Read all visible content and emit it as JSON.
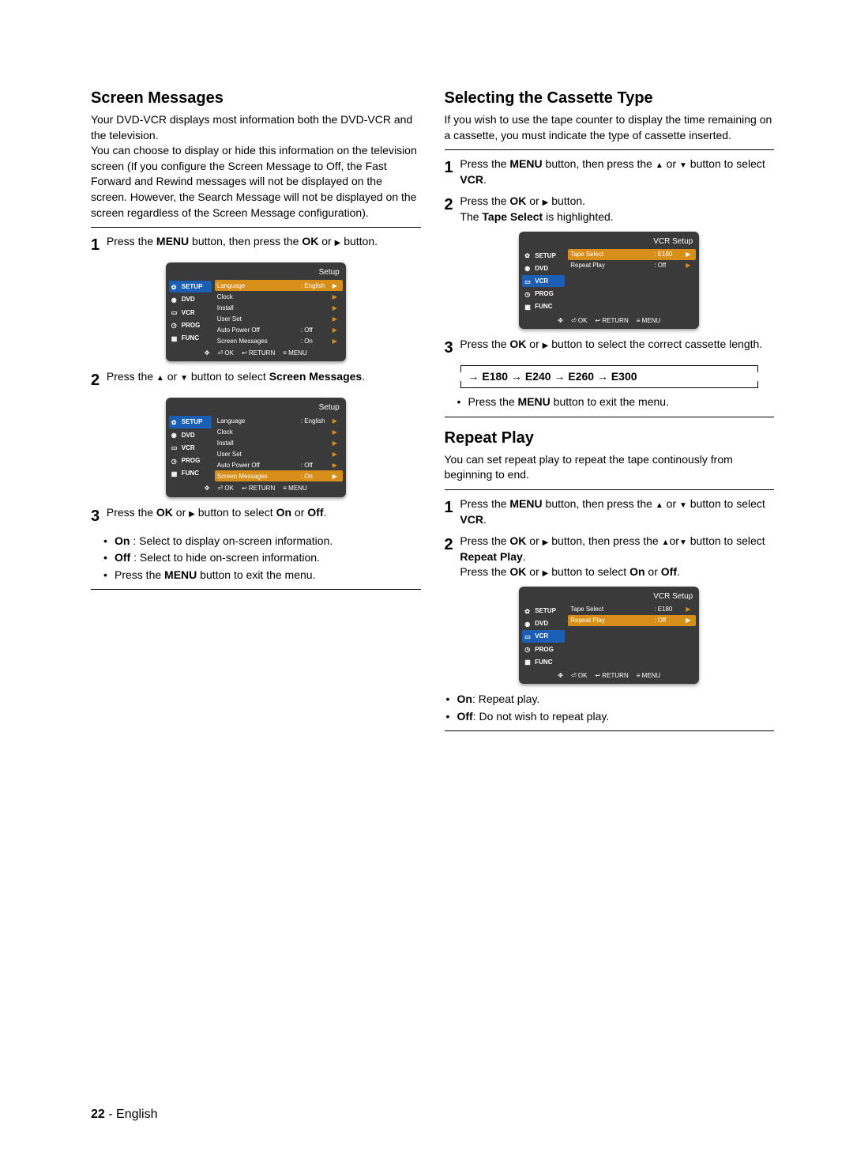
{
  "left": {
    "heading": "Screen Messages",
    "intro": "Your DVD-VCR displays most information both the DVD-VCR and the television.\nYou can choose to display or hide this information on the television screen (If you configure the Screen Message to Off, the Fast Forward and Rewind messages will not be displayed on the screen. However, the Search Message will not be displayed on the screen regardless of the Screen Message configuration).",
    "step1_a": "Press the ",
    "step1_menu": "MENU",
    "step1_b": " button, then press the ",
    "step1_ok": "OK",
    "step1_c": " or ",
    "step1_d": " button.",
    "step2_a": "Press the ",
    "step2_b": " or ",
    "step2_c": " button to select ",
    "step2_sm": "Screen Messages",
    "step2_d": ".",
    "step3_a": "Press the ",
    "step3_ok": "OK",
    "step3_b": " or ",
    "step3_c": " button to select ",
    "step3_on": "On",
    "step3_d": " or ",
    "step3_off": "Off",
    "step3_e": ".",
    "bullet_on_a": "On",
    "bullet_on_b": " : Select to display on-screen information.",
    "bullet_off_a": "Off",
    "bullet_off_b": " : Select to hide on-screen information.",
    "bullet_exit_a": "Press the ",
    "bullet_exit_menu": "MENU",
    "bullet_exit_b": " button to exit the menu."
  },
  "right": {
    "sec1_heading": "Selecting the Cassette Type",
    "sec1_intro": "If you wish to use the tape counter to display the time remaining on a cassette, you must indicate the type of cassette inserted.",
    "s1_step1_a": "Press the ",
    "s1_step1_menu": "MENU",
    "s1_step1_b": " button, then press the ",
    "s1_step1_c": " or ",
    "s1_step1_d": " button to select ",
    "s1_step1_vcr": "VCR",
    "s1_step1_e": ".",
    "s1_step2_a": "Press the ",
    "s1_step2_ok": "OK",
    "s1_step2_b": " or ",
    "s1_step2_c": " button.",
    "s1_step2_d": "The ",
    "s1_step2_ts": "Tape Select",
    "s1_step2_e": " is highlighted.",
    "s1_step3_a": "Press the ",
    "s1_step3_ok": "OK",
    "s1_step3_b": " or ",
    "s1_step3_c": " button to select the correct cassette length.",
    "seq": {
      "e180": "E180",
      "e240": "E240",
      "e260": "E260",
      "e300": "E300"
    },
    "s1_exit_a": "Press the ",
    "s1_exit_menu": "MENU",
    "s1_exit_b": " button to exit the menu.",
    "sec2_heading": "Repeat Play",
    "sec2_intro": "You can set repeat play to repeat the tape continously from beginning to end.",
    "s2_step1_a": "Press the ",
    "s2_step1_menu": "MENU",
    "s2_step1_b": " button, then press the ",
    "s2_step1_c": " or ",
    "s2_step1_d": " button to select ",
    "s2_step1_vcr": "VCR",
    "s2_step1_e": ".",
    "s2_step2_a": "Press the ",
    "s2_step2_ok": "OK",
    "s2_step2_b": " or ",
    "s2_step2_c": " button, then press the ",
    "s2_step2_d": "or",
    "s2_step2_e": " button to select ",
    "s2_step2_rp": "Repeat Play",
    "s2_step2_f": ".",
    "s2_step2_g": "Press the ",
    "s2_step2_ok2": "OK",
    "s2_step2_h": " or ",
    "s2_step2_i": " button to select ",
    "s2_step2_on": "On",
    "s2_step2_j": " or ",
    "s2_step2_off": "Off",
    "s2_step2_k": ".",
    "s2_bul_on_a": "On",
    "s2_bul_on_b": ": Repeat play.",
    "s2_bul_off_a": "Off",
    "s2_bul_off_b": ": Do not wish to repeat play."
  },
  "osd": {
    "setup_title": "Setup",
    "vcr_title": "VCR Setup",
    "tabs": {
      "setup": "SETUP",
      "dvd": "DVD",
      "vcr": "VCR",
      "prog": "PROG",
      "func": "FUNC"
    },
    "setup_rows": {
      "language": "Language",
      "language_val": ": English",
      "clock": "Clock",
      "install": "Install",
      "userset": "User Set",
      "autopower": "Auto Power Off",
      "autopower_val": ": Off",
      "screenmsg": "Screen Messages",
      "screenmsg_val": ": On"
    },
    "vcr_rows": {
      "tapeselect": "Tape Select",
      "tapeselect_val": ": E180",
      "repeatplay": "Repeat Play",
      "repeatplay_val": ": Off"
    },
    "footer": {
      "ok": "OK",
      "return": "RETURN",
      "menu": "MENU"
    }
  },
  "nums": {
    "n1": "1",
    "n2": "2",
    "n3": "3"
  },
  "footer": {
    "page": "22",
    "sep": " - ",
    "lang": "English"
  }
}
